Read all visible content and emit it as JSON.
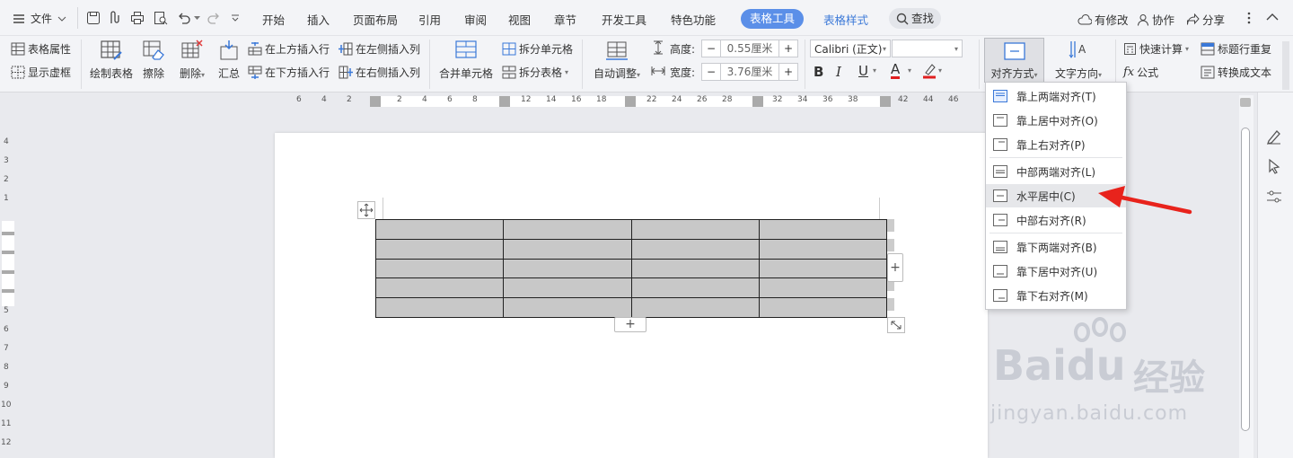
{
  "menubar": {
    "file_label": "文件",
    "tabs": [
      "开始",
      "插入",
      "页面布局",
      "引用",
      "审阅",
      "视图",
      "章节",
      "开发工具",
      "特色功能"
    ],
    "active_tab": "表格工具",
    "tab_table_style": "表格样式",
    "search_label": "查找",
    "modified_label": "有修改",
    "collab_label": "协作",
    "share_label": "分享"
  },
  "ribbon": {
    "table_props": "表格属性",
    "show_gridlines": "显示虚框",
    "draw_table": "绘制表格",
    "erase": "擦除",
    "delete": "删除",
    "summary": "汇总",
    "insert_row_above": "在上方插入行",
    "insert_row_below": "在下方插入行",
    "insert_col_left": "在左侧插入列",
    "insert_col_right": "在右侧插入列",
    "merge_cells": "合并单元格",
    "split_cells": "拆分单元格",
    "split_table": "拆分表格",
    "autofit": "自动调整",
    "height_label": "高度:",
    "height_value": "0.55厘米",
    "width_label": "宽度:",
    "width_value": "3.76厘米",
    "font_name": "Calibri (正文)",
    "align_mode": "对齐方式",
    "text_direction": "文字方向",
    "quick_calc": "快速计算",
    "repeat_header": "标题行重复",
    "formula": "公式",
    "to_text": "转换成文本"
  },
  "ruler": {
    "h_ticks": [
      "6",
      "4",
      "2",
      "2",
      "4",
      "6",
      "8",
      "12",
      "14",
      "16",
      "18",
      "22",
      "24",
      "26",
      "28",
      "32",
      "34",
      "36",
      "38",
      "42",
      "44",
      "46"
    ],
    "v_ticks": [
      "4",
      "3",
      "2",
      "1",
      "5",
      "6",
      "7",
      "8",
      "9",
      "10",
      "11",
      "12"
    ]
  },
  "dropdown": {
    "items": [
      "靠上两端对齐(T)",
      "靠上居中对齐(O)",
      "靠上右对齐(P)",
      "中部两端对齐(L)",
      "水平居中(C)",
      "中部右对齐(R)",
      "靠下两端对齐(B)",
      "靠下居中对齐(U)",
      "靠下右对齐(M)"
    ],
    "highlighted_index": 4
  },
  "document": {
    "table_rows": 5,
    "table_cols": 4,
    "table_fill": "#c8c8c8"
  },
  "colors": {
    "accent": "#5b8fe8",
    "arrow": "#e8231c"
  },
  "watermark": {
    "brand": "Baidu",
    "brand_cn": "经验",
    "url": "jingyan.baidu.com"
  }
}
